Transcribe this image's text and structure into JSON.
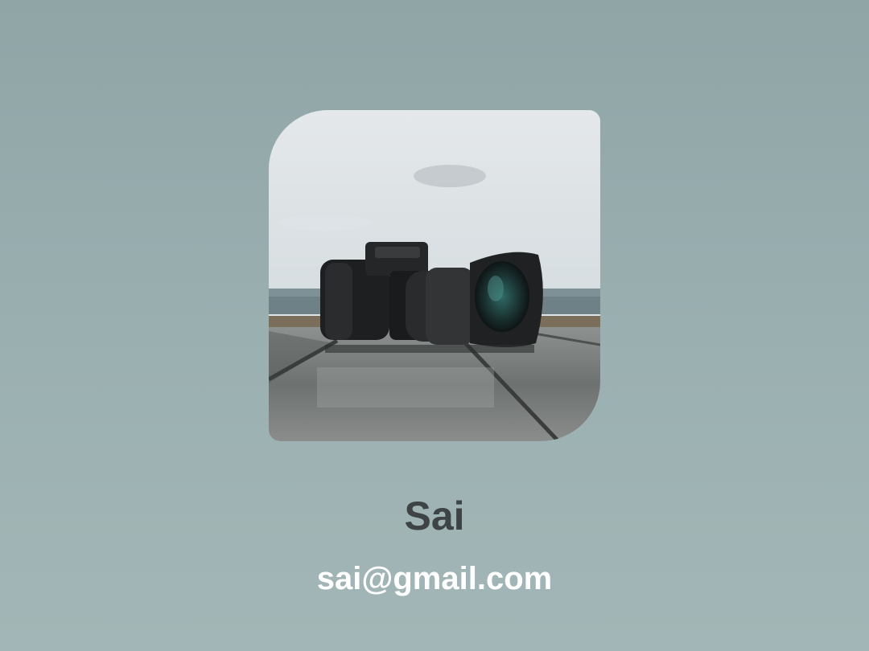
{
  "profile": {
    "name": "Sai",
    "email": "sai@gmail.com",
    "avatar_icon": "camera-photo"
  },
  "colors": {
    "background": "#9bb0b1",
    "name_text": "#3e4445",
    "email_text": "#ffffff"
  }
}
